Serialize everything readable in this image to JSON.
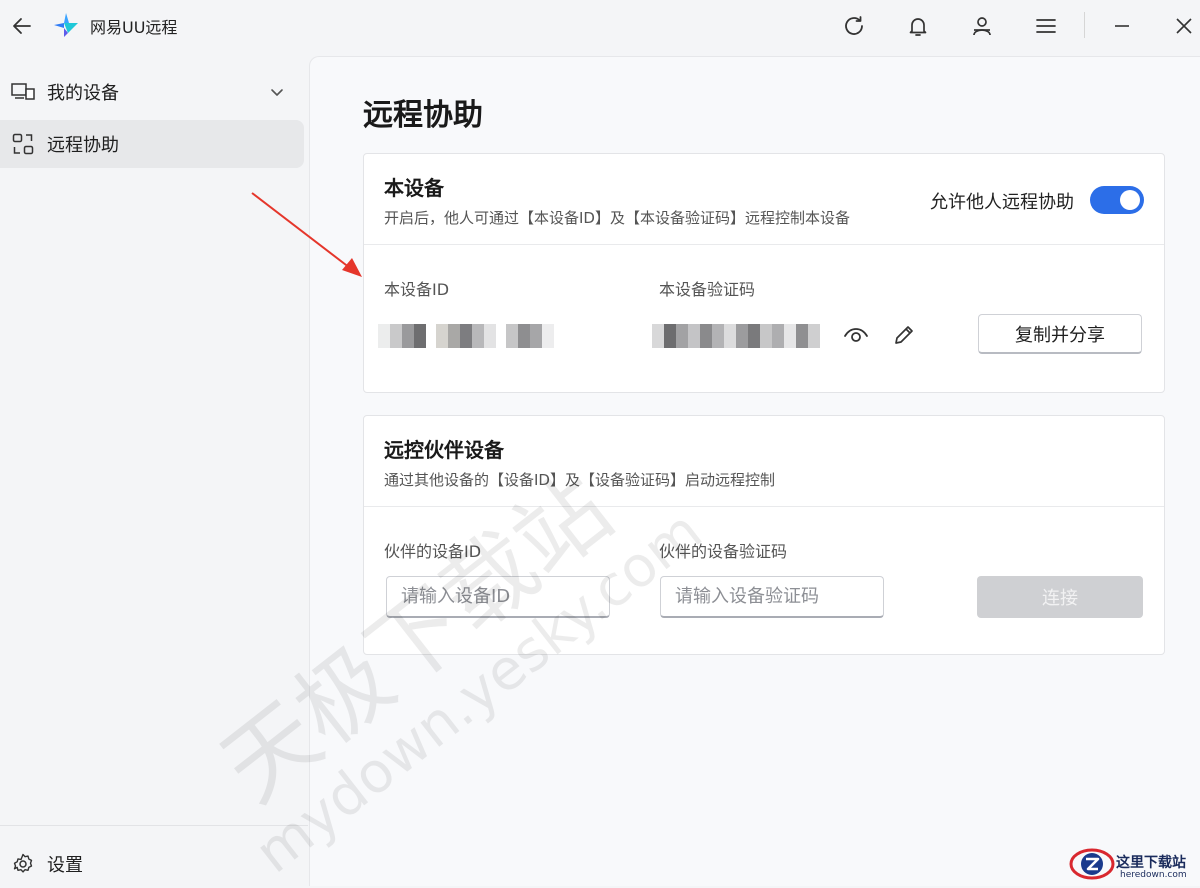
{
  "app": {
    "title": "网易UU远程"
  },
  "sidebar": {
    "items": [
      {
        "label": "我的设备"
      },
      {
        "label": "远程协助"
      }
    ],
    "settings_label": "设置"
  },
  "page": {
    "title": "远程协助"
  },
  "this_device": {
    "title": "本设备",
    "subtitle": "开启后，他人可通过【本设备ID】及【本设备验证码】远程控制本设备",
    "toggle_label": "允许他人远程协助",
    "toggle_on": true,
    "id_label": "本设备ID",
    "code_label": "本设备验证码",
    "copy_button": "复制并分享"
  },
  "partner": {
    "title": "远控伙伴设备",
    "subtitle": "通过其他设备的【设备ID】及【设备验证码】启动远程控制",
    "id_label": "伙伴的设备ID",
    "code_label": "伙伴的设备验证码",
    "id_placeholder": "请输入设备ID",
    "code_placeholder": "请输入设备验证码",
    "connect_button": "连接"
  },
  "watermark": {
    "cn": "天极下载站",
    "url": "mydown.yesky.com"
  },
  "badge": {
    "name": "这里下载站",
    "url": "heredown.com"
  },
  "colors": {
    "accent": "#2c6ee8",
    "arrow": "#e5362b"
  },
  "icons": {
    "back": "arrow-left-icon",
    "refresh": "refresh-icon",
    "bell": "bell-icon",
    "user": "user-icon",
    "menu": "menu-icon",
    "minimize": "minimize-icon",
    "close": "close-icon",
    "eye": "eye-icon",
    "edit": "pencil-icon"
  }
}
